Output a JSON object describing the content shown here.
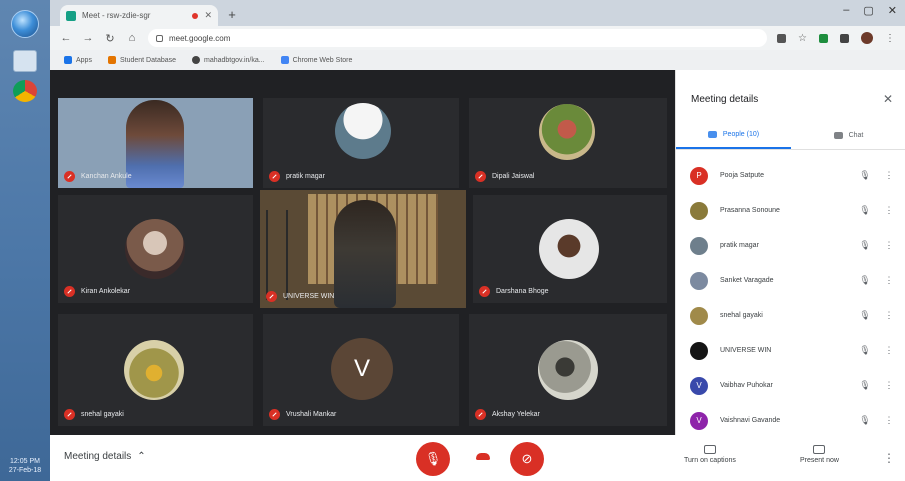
{
  "taskbar": {
    "clock_time": "12:05 PM",
    "clock_date": "27-Feb-18"
  },
  "browser": {
    "tab_title": "Meet - rsw-zdie-sgr",
    "url": "meet.google.com",
    "bookmarks": [
      "Apps",
      "Student Database",
      "mahadbtgov.in/ka...",
      "Chrome Web Store"
    ]
  },
  "meet": {
    "tiles": [
      {
        "name": "Kanchan Ankule",
        "kind": "video",
        "bg": "#8aa0b6"
      },
      {
        "name": "pratik magar",
        "kind": "avatar",
        "avatar_color": "#7f8c8d"
      },
      {
        "name": "Dipali Jaiswal",
        "kind": "avatar",
        "avatar_color": "#9aa86a"
      },
      {
        "name": "Kiran Ankolekar",
        "kind": "avatar",
        "avatar_color": "#7a6a5a"
      },
      {
        "name": "UNIVERSE WIN",
        "kind": "video",
        "bg": "#5a4a35"
      },
      {
        "name": "Darshana Bhoge",
        "kind": "avatar",
        "avatar_color": "#d9d9d9"
      },
      {
        "name": "snehal gayaki",
        "kind": "avatar",
        "avatar_color": "#b9a36a"
      },
      {
        "name": "Vrushali Mankar",
        "kind": "letter",
        "letter": "V",
        "avatar_color": "#5b4636"
      },
      {
        "name": "Akshay Yelekar",
        "kind": "avatar",
        "avatar_color": "#8a8a80"
      }
    ]
  },
  "controls": {
    "meeting_details": "Meeting details",
    "captions": "Turn on captions",
    "present": "Present now"
  },
  "panel": {
    "title": "Meeting details",
    "people_tab": "People (10)",
    "chat_tab": "Chat",
    "people": [
      {
        "name": "Pooja Satpute",
        "color": "#d93025",
        "letter": "P"
      },
      {
        "name": "Prasanna Sonoune",
        "color": "#8a7a3a",
        "letter": ""
      },
      {
        "name": "pratik magar",
        "color": "#6e7f8c",
        "letter": ""
      },
      {
        "name": "Sanket Varagade",
        "color": "#7c8aa0",
        "letter": ""
      },
      {
        "name": "snehal gayaki",
        "color": "#a08a4a",
        "letter": ""
      },
      {
        "name": "UNIVERSE WIN",
        "color": "#151515",
        "letter": ""
      },
      {
        "name": "Vaibhav Puhokar",
        "color": "#3949ab",
        "letter": "V"
      },
      {
        "name": "Vaishnavi Gavande",
        "color": "#8e24aa",
        "letter": "V"
      }
    ]
  }
}
